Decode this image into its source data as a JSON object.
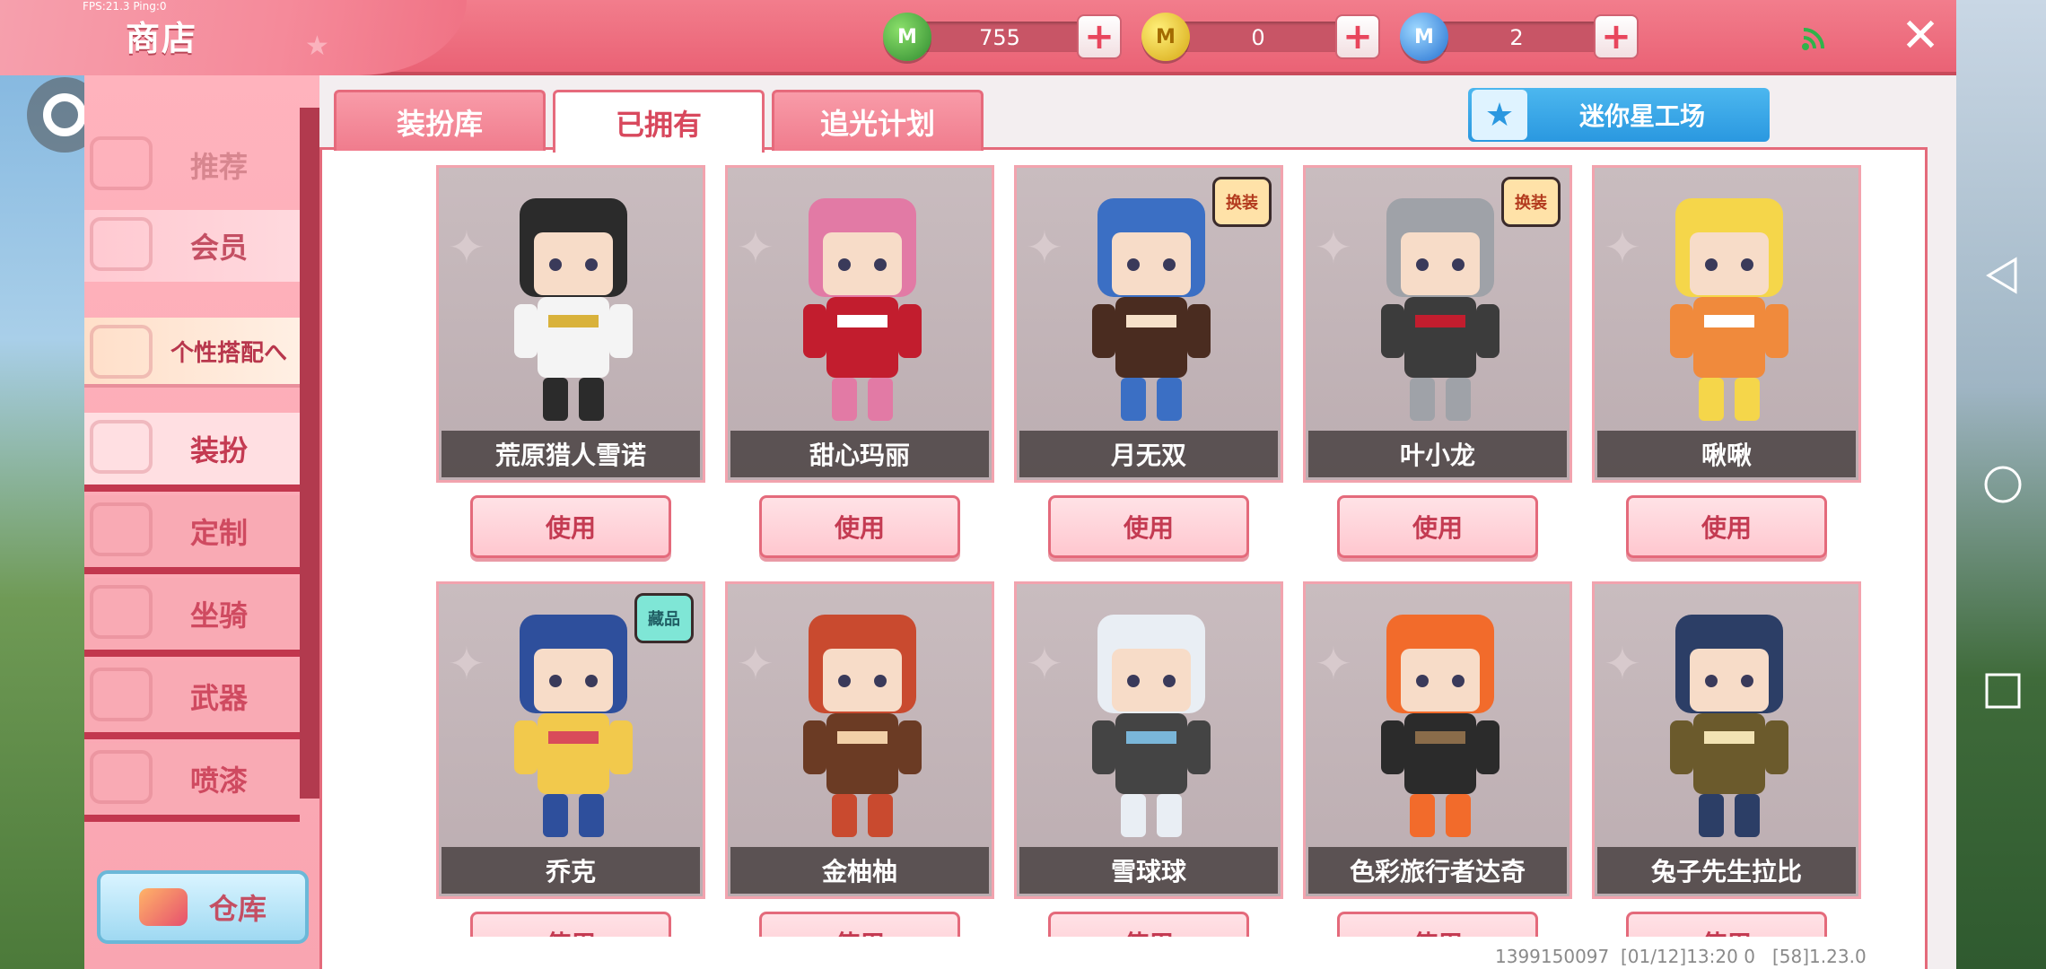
{
  "debug": {
    "fps": "FPS:21.3  Ping:0"
  },
  "header": {
    "title": "商店"
  },
  "currency": [
    {
      "icon": "green-m-coin-icon",
      "glyph": "M",
      "value": "755"
    },
    {
      "icon": "gold-m-coin-icon",
      "glyph": "M",
      "value": "0"
    },
    {
      "icon": "blue-m-coin-icon",
      "glyph": "M",
      "value": "2"
    }
  ],
  "plus_glyph": "+",
  "close_glyph": "✕",
  "sidebar": {
    "items": [
      {
        "label": "推荐"
      },
      {
        "label": "会员"
      },
      {
        "label": "个性搭配へ"
      },
      {
        "label": "装扮"
      },
      {
        "label": "定制"
      },
      {
        "label": "坐骑"
      },
      {
        "label": "武器"
      },
      {
        "label": "喷漆"
      }
    ],
    "warehouse_label": "仓库"
  },
  "tabs": [
    {
      "label": "装扮库"
    },
    {
      "label": "已拥有"
    },
    {
      "label": "追光计划"
    }
  ],
  "mini_star_factory": {
    "label": "迷你星工场",
    "star": "★"
  },
  "use_label": "使用",
  "cards": [
    {
      "name": "荒原猎人雪诺",
      "badge": ""
    },
    {
      "name": "甜心玛丽",
      "badge": ""
    },
    {
      "name": "月无双",
      "badge": "换装"
    },
    {
      "name": "叶小龙",
      "badge": "换装"
    },
    {
      "name": "啾啾",
      "badge": ""
    },
    {
      "name": "乔克",
      "badge": "藏品"
    },
    {
      "name": "金柚柚",
      "badge": ""
    },
    {
      "name": "雪球球",
      "badge": ""
    },
    {
      "name": "色彩旅行者达奇",
      "badge": ""
    },
    {
      "name": "兔子先生拉比",
      "badge": ""
    }
  ],
  "footer": {
    "info": "1399150097  [01/12]13:20 0   [58]1.23.0"
  },
  "colors": {
    "accent": "#ea6275",
    "tab_active_text": "#d8485d",
    "mini_btn": "#2a98e0"
  }
}
